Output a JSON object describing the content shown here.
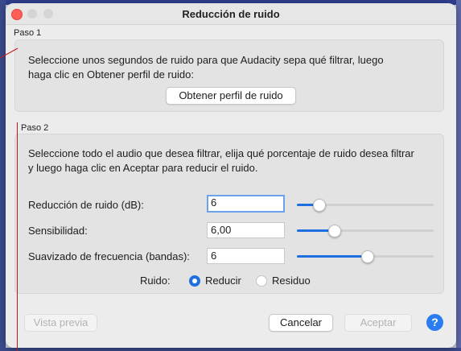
{
  "window": {
    "title": "Reducción de ruido"
  },
  "step1": {
    "label": "Paso 1",
    "description_line1": "Seleccione unos segundos de ruido para que Audacity sepa qué filtrar, luego",
    "description_line2": "haga clic en Obtener perfil de ruido:",
    "get_profile_button": "Obtener perfil de ruido"
  },
  "step2": {
    "label": "Paso 2",
    "description_line1": "Seleccione todo el audio que desea filtrar, elija qué porcentaje de ruido desea filtrar",
    "description_line2": "y luego haga clic en Aceptar para reducir el ruido.",
    "noise_reduction": {
      "label": "Reducción de ruido (dB):",
      "value": "6",
      "slider_fraction": 0.16
    },
    "sensitivity": {
      "label": "Sensibilidad:",
      "value": "6,00",
      "slider_fraction": 0.27
    },
    "frequency_smoothing": {
      "label": "Suavizado de frecuencia (bandas):",
      "value": "6",
      "slider_fraction": 0.51
    },
    "noise_mode": {
      "label": "Ruido:",
      "options": [
        "Reducir",
        "Residuo"
      ],
      "selected": "Reducir"
    }
  },
  "footer": {
    "preview_button": "Vista previa",
    "cancel_button": "Cancelar",
    "ok_button": "Aceptar",
    "help_button": "?"
  },
  "colors": {
    "accent": "#1f6fe0",
    "close": "#ff5f57",
    "help": "#2b7cf0"
  }
}
